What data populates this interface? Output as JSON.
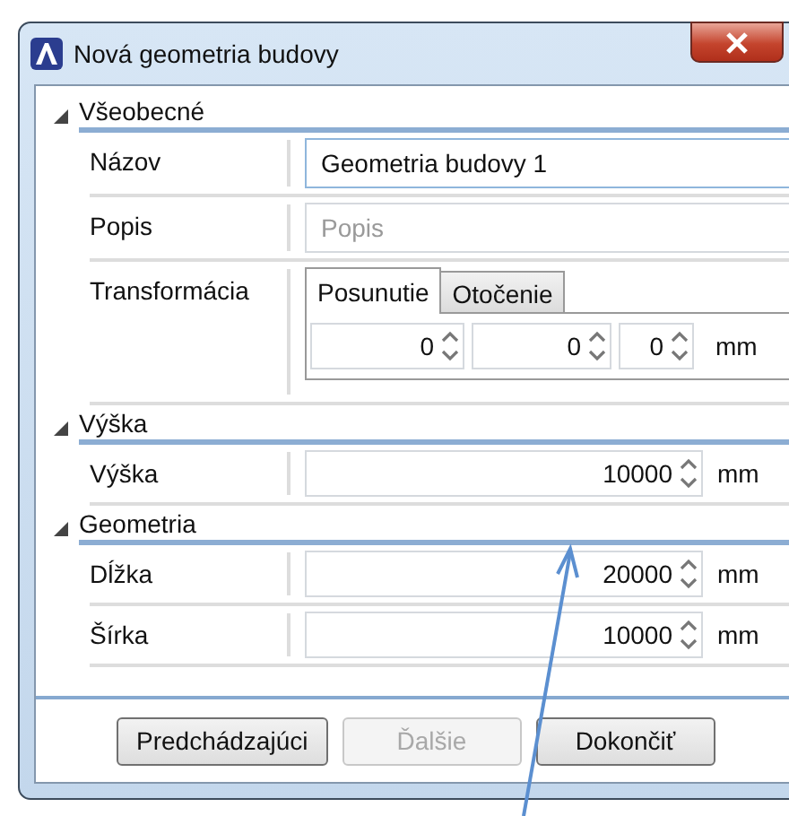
{
  "window": {
    "title": "Nová geometria budovy"
  },
  "sections": [
    {
      "title": "Všeobecné",
      "expanded": true,
      "rows": [
        {
          "kind": "text",
          "label": "Názov",
          "value": "Geometria budovy 1",
          "focused": true
        },
        {
          "kind": "text",
          "label": "Popis",
          "placeholder": "Popis",
          "focused": false
        },
        {
          "kind": "tabs",
          "label": "Transformácia",
          "tabs": [
            {
              "label": "Posunutie",
              "selected": true
            },
            {
              "label": "Otočenie",
              "selected": false
            }
          ],
          "fields": [
            "0",
            "0",
            "0"
          ],
          "unit": "mm"
        }
      ]
    },
    {
      "title": "Výška",
      "expanded": true,
      "rows": [
        {
          "kind": "number",
          "label": "Výška",
          "value": "10000",
          "unit": "mm"
        }
      ]
    },
    {
      "title": "Geometria",
      "expanded": true,
      "rows": [
        {
          "kind": "number",
          "label": "Dĺžka",
          "value": "20000",
          "unit": "mm"
        },
        {
          "kind": "number",
          "label": "Šírka",
          "value": "10000",
          "unit": "mm"
        }
      ]
    }
  ],
  "buttons": [
    {
      "label": "Predchádzajúci",
      "disabled": false
    },
    {
      "label": "Ďalšie",
      "disabled": true
    },
    {
      "label": "Dokončiť",
      "disabled": false
    }
  ]
}
